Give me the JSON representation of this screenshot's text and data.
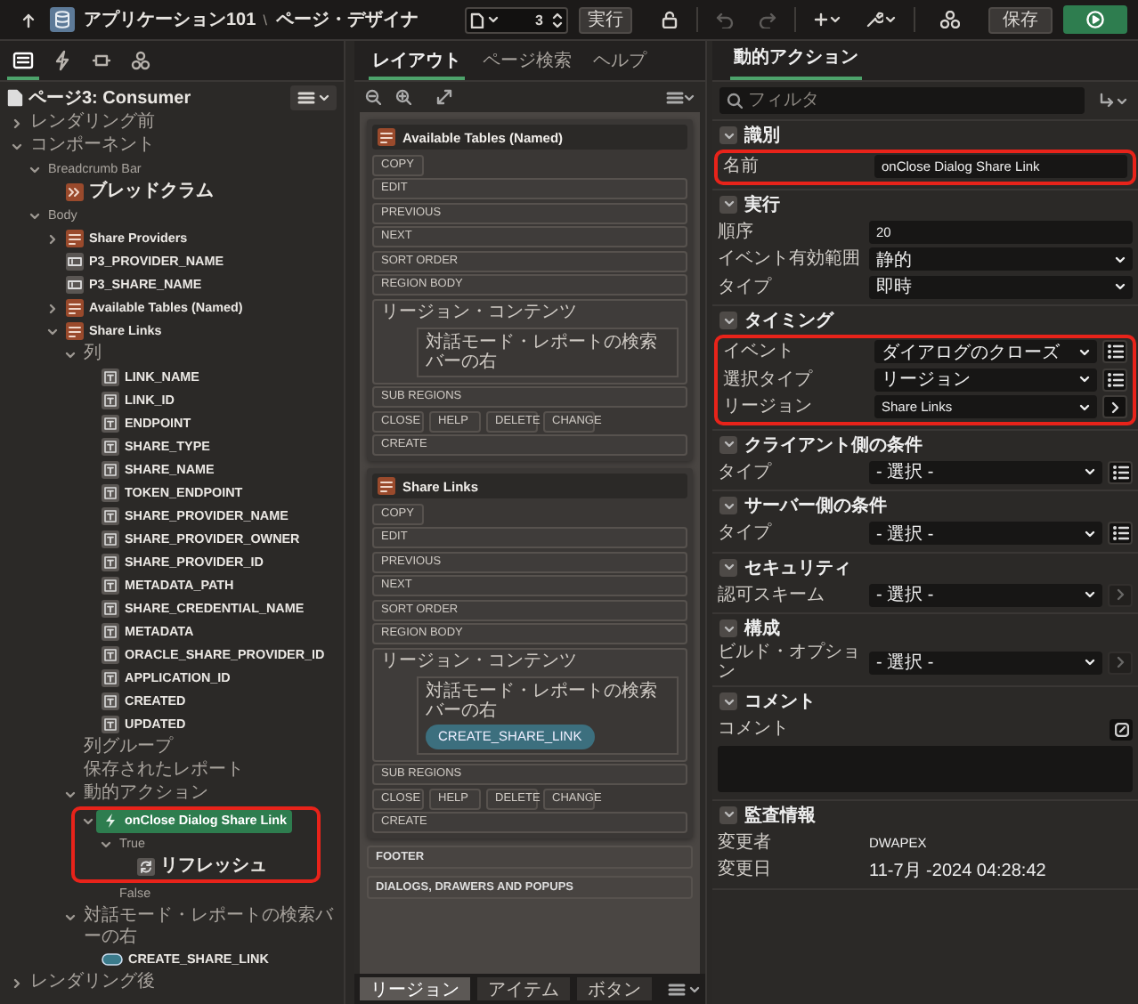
{
  "header": {
    "app": "アプリケーション101",
    "separator": "\\",
    "page": "ページ・デザイナ",
    "page_number": "3",
    "run": "実行",
    "undo_disabled": true,
    "redo_disabled": true,
    "save": "保存"
  },
  "left_tabs": [
    {
      "kind": "rendering",
      "selected": true
    },
    {
      "kind": "dynamic-actions",
      "selected": false
    },
    {
      "kind": "processing",
      "selected": false
    },
    {
      "kind": "shared",
      "selected": false
    }
  ],
  "tree": {
    "title": "ページ3: Consumer",
    "nodes": [
      {
        "label": "レンダリング前",
        "kind": "folder",
        "expanded": false,
        "selected": false,
        "annotated": false
      },
      {
        "label": "コンポーネント",
        "kind": "folder",
        "expanded": true,
        "selected": false,
        "annotated": false,
        "children": [
          {
            "label": "Breadcrumb Bar",
            "kind": "folder",
            "expanded": true,
            "selected": false,
            "annotated": false,
            "children": [
              {
                "label": "ブレッドクラム",
                "kind": "breadcrumb",
                "selected": false,
                "annotated": false
              }
            ]
          },
          {
            "label": "Body",
            "kind": "folder",
            "expanded": true,
            "selected": false,
            "annotated": false,
            "children": [
              {
                "label": "Share Providers",
                "kind": "region",
                "expanded": false,
                "selected": false,
                "annotated": false
              },
              {
                "label": "P3_PROVIDER_NAME",
                "kind": "item",
                "selected": false,
                "annotated": false
              },
              {
                "label": "P3_SHARE_NAME",
                "kind": "item",
                "selected": false,
                "annotated": false
              },
              {
                "label": "Available Tables (Named)",
                "kind": "region",
                "expanded": false,
                "selected": false,
                "annotated": false
              },
              {
                "label": "Share Links",
                "kind": "region",
                "expanded": true,
                "selected": false,
                "annotated": false,
                "children": [
                  {
                    "label": "列",
                    "kind": "folder",
                    "expanded": true,
                    "selected": false,
                    "annotated": false,
                    "children": [
                      {
                        "label": "LINK_NAME",
                        "kind": "column",
                        "selected": false,
                        "annotated": false
                      },
                      {
                        "label": "LINK_ID",
                        "kind": "column",
                        "selected": false,
                        "annotated": false
                      },
                      {
                        "label": "ENDPOINT",
                        "kind": "column",
                        "selected": false,
                        "annotated": false
                      },
                      {
                        "label": "SHARE_TYPE",
                        "kind": "column",
                        "selected": false,
                        "annotated": false
                      },
                      {
                        "label": "SHARE_NAME",
                        "kind": "column",
                        "selected": false,
                        "annotated": false
                      },
                      {
                        "label": "TOKEN_ENDPOINT",
                        "kind": "column",
                        "selected": false,
                        "annotated": false
                      },
                      {
                        "label": "SHARE_PROVIDER_NAME",
                        "kind": "column",
                        "selected": false,
                        "annotated": false
                      },
                      {
                        "label": "SHARE_PROVIDER_OWNER",
                        "kind": "column",
                        "selected": false,
                        "annotated": false
                      },
                      {
                        "label": "SHARE_PROVIDER_ID",
                        "kind": "column",
                        "selected": false,
                        "annotated": false
                      },
                      {
                        "label": "METADATA_PATH",
                        "kind": "column",
                        "selected": false,
                        "annotated": false
                      },
                      {
                        "label": "SHARE_CREDENTIAL_NAME",
                        "kind": "column",
                        "selected": false,
                        "annotated": false
                      },
                      {
                        "label": "METADATA",
                        "kind": "column",
                        "selected": false,
                        "annotated": false
                      },
                      {
                        "label": "ORACLE_SHARE_PROVIDER_ID",
                        "kind": "column",
                        "selected": false,
                        "annotated": false
                      },
                      {
                        "label": "APPLICATION_ID",
                        "kind": "column",
                        "selected": false,
                        "annotated": false
                      },
                      {
                        "label": "CREATED",
                        "kind": "column",
                        "selected": false,
                        "annotated": false
                      },
                      {
                        "label": "UPDATED",
                        "kind": "column",
                        "selected": false,
                        "annotated": false
                      }
                    ]
                  },
                  {
                    "label": "列グループ",
                    "kind": "folder",
                    "selected": false,
                    "annotated": false
                  },
                  {
                    "label": "保存されたレポート",
                    "kind": "folder",
                    "selected": false,
                    "annotated": false
                  },
                  {
                    "label": "動的アクション",
                    "kind": "folder",
                    "expanded": true,
                    "selected": false,
                    "annotated": false,
                    "children": [
                      {
                        "label": "onClose Dialog Share Link",
                        "kind": "dynamic-action",
                        "expanded": true,
                        "selected": true,
                        "annotated": true,
                        "children": [
                          {
                            "label": "True",
                            "kind": "folder",
                            "expanded": true,
                            "selected": false,
                            "annotated": true,
                            "children": [
                              {
                                "label": "リフレッシュ",
                                "kind": "action",
                                "selected": false,
                                "annotated": true
                              }
                            ]
                          },
                          {
                            "label": "False",
                            "kind": "folder",
                            "selected": false,
                            "annotated": false
                          }
                        ]
                      }
                    ]
                  },
                  {
                    "label": "対話モード・レポートの検索バーの右",
                    "kind": "folder",
                    "expanded": true,
                    "selected": false,
                    "annotated": false,
                    "children": [
                      {
                        "label": "CREATE_SHARE_LINK",
                        "kind": "button",
                        "selected": false,
                        "annotated": false
                      }
                    ]
                  }
                ]
              }
            ]
          }
        ]
      },
      {
        "label": "レンダリング後",
        "kind": "folder",
        "expanded": false,
        "selected": false,
        "annotated": false
      }
    ]
  },
  "layout": {
    "tabs": [
      {
        "label": "レイアウト",
        "selected": true
      },
      {
        "label": "ページ検索",
        "selected": false
      },
      {
        "label": "ヘルプ",
        "selected": false
      }
    ],
    "regions": [
      {
        "title": "Available Tables (Named)",
        "slots": [
          {
            "kind": "buttons",
            "labels": [
              "COPY"
            ]
          },
          {
            "kind": "slot",
            "label": "EDIT"
          },
          {
            "kind": "slot",
            "label": "PREVIOUS"
          },
          {
            "kind": "slot",
            "label": "NEXT"
          },
          {
            "kind": "slot",
            "label": "SORT ORDER"
          },
          {
            "kind": "slot",
            "label": "REGION BODY"
          },
          {
            "kind": "content",
            "label": "リージョン・コンテンツ",
            "inner": {
              "label": "対話モード・レポートの検索バーの右"
            }
          },
          {
            "kind": "slot",
            "label": "SUB REGIONS"
          },
          {
            "kind": "buttons",
            "labels": [
              "CLOSE",
              "HELP",
              "DELETE",
              "CHANGE"
            ]
          },
          {
            "kind": "slot",
            "label": "CREATE"
          }
        ]
      },
      {
        "title": "Share Links",
        "slots": [
          {
            "kind": "buttons",
            "labels": [
              "COPY"
            ]
          },
          {
            "kind": "slot",
            "label": "EDIT"
          },
          {
            "kind": "slot",
            "label": "PREVIOUS"
          },
          {
            "kind": "slot",
            "label": "NEXT"
          },
          {
            "kind": "slot",
            "label": "SORT ORDER"
          },
          {
            "kind": "slot",
            "label": "REGION BODY"
          },
          {
            "kind": "content",
            "label": "リージョン・コンテンツ",
            "inner": {
              "label": "対話モード・レポートの検索バーの右",
              "buttons": [
                "CREATE_SHARE_LINK"
              ]
            }
          },
          {
            "kind": "slot",
            "label": "SUB REGIONS"
          },
          {
            "kind": "buttons",
            "labels": [
              "CLOSE",
              "HELP",
              "DELETE",
              "CHANGE"
            ]
          },
          {
            "kind": "slot",
            "label": "CREATE"
          }
        ]
      }
    ],
    "page_slots": [
      "FOOTER",
      "DIALOGS, DRAWERS AND POPUPS"
    ],
    "bottom_tabs": [
      {
        "label": "リージョン",
        "selected": true
      },
      {
        "label": "アイテム",
        "selected": false
      },
      {
        "label": "ボタン",
        "selected": false
      }
    ]
  },
  "properties": {
    "tab": "動的アクション",
    "filter_placeholder": "フィルタ",
    "sections": [
      {
        "title": "識別",
        "expanded": true,
        "fields": [
          {
            "label": "名前",
            "kind": "text",
            "value": "onClose Dialog Share Link",
            "annotated": true
          }
        ]
      },
      {
        "title": "実行",
        "expanded": true,
        "fields": [
          {
            "label": "順序",
            "kind": "text",
            "value": "20",
            "annotated": false
          },
          {
            "label": "イベント有効範囲",
            "kind": "select",
            "value": "静的",
            "annotated": false
          },
          {
            "label": "タイプ",
            "kind": "select",
            "value": "即時",
            "annotated": false
          }
        ]
      },
      {
        "title": "タイミング",
        "expanded": true,
        "fields": [
          {
            "label": "イベント",
            "kind": "select",
            "value": "ダイアログのクローズ",
            "button": {
              "kind": "list",
              "disabled": false
            },
            "annotated": true
          },
          {
            "label": "選択タイプ",
            "kind": "select",
            "value": "リージョン",
            "button": {
              "kind": "list",
              "disabled": false
            },
            "annotated": true
          },
          {
            "label": "リージョン",
            "kind": "select",
            "value": "Share Links",
            "button": {
              "kind": "next",
              "disabled": false
            },
            "annotated": true
          }
        ]
      },
      {
        "title": "クライアント側の条件",
        "expanded": true,
        "fields": [
          {
            "label": "タイプ",
            "kind": "select",
            "value": "- 選択 -",
            "button": {
              "kind": "list",
              "disabled": false
            },
            "annotated": false
          }
        ]
      },
      {
        "title": "サーバー側の条件",
        "expanded": true,
        "fields": [
          {
            "label": "タイプ",
            "kind": "select",
            "value": "- 選択 -",
            "button": {
              "kind": "list",
              "disabled": false
            },
            "annotated": false
          }
        ]
      },
      {
        "title": "セキュリティ",
        "expanded": true,
        "fields": [
          {
            "label": "認可スキーム",
            "kind": "select",
            "value": "- 選択 -",
            "button": {
              "kind": "next",
              "disabled": true
            },
            "annotated": false
          }
        ]
      },
      {
        "title": "構成",
        "expanded": true,
        "fields": [
          {
            "label": "ビルド・オプション",
            "kind": "select",
            "value": "- 選択 -",
            "button": {
              "kind": "next",
              "disabled": true
            },
            "annotated": false
          }
        ]
      },
      {
        "title": "コメント",
        "expanded": true,
        "fields": [
          {
            "label": "コメント",
            "kind": "textarea",
            "annotated": false
          }
        ]
      },
      {
        "title": "監査情報",
        "expanded": true,
        "fields": [
          {
            "label": "変更者",
            "kind": "display",
            "value": "DWAPEX",
            "annotated": false
          },
          {
            "label": "変更日",
            "kind": "display",
            "value": "11-7月 -2024 04:28:42",
            "annotated": false
          }
        ]
      }
    ]
  }
}
